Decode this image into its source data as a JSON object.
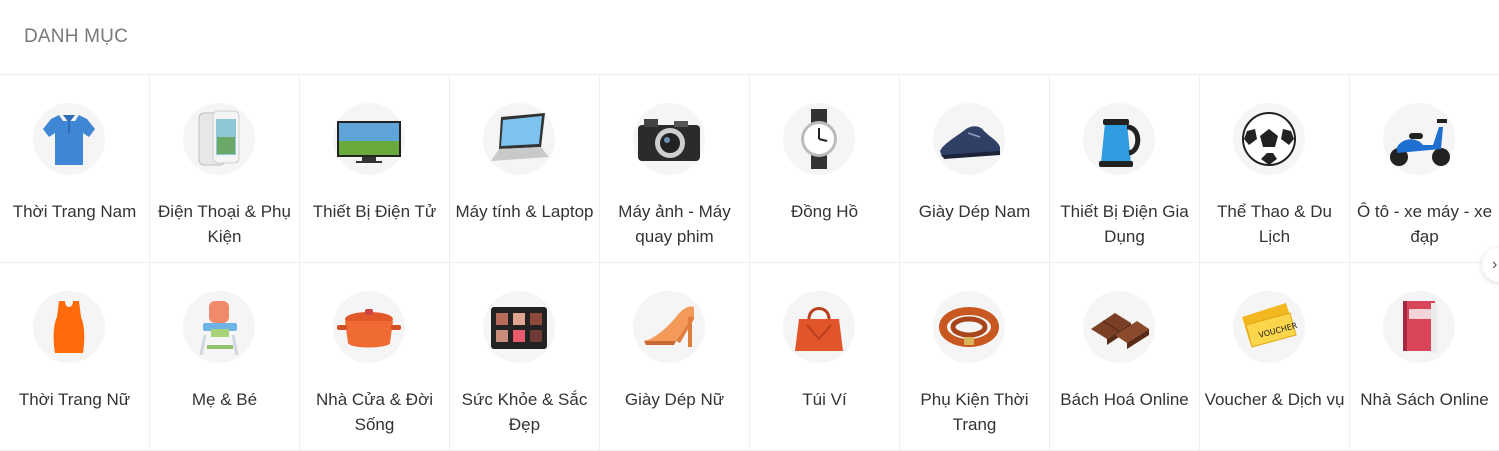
{
  "header": {
    "title": "DANH MỤC"
  },
  "categories": [
    {
      "label": "Thời Trang Nam",
      "icon": "polo-shirt-icon"
    },
    {
      "label": "Điện Thoại & Phụ Kiện",
      "icon": "smartphone-icon"
    },
    {
      "label": "Thiết Bị Điện Tử",
      "icon": "television-icon"
    },
    {
      "label": "Máy tính & Laptop",
      "icon": "laptop-icon"
    },
    {
      "label": "Máy ảnh - Máy quay phim",
      "icon": "camera-icon"
    },
    {
      "label": "Đồng Hồ",
      "icon": "wristwatch-icon"
    },
    {
      "label": "Giày Dép Nam",
      "icon": "men-shoe-icon"
    },
    {
      "label": "Thiết Bị Điện Gia Dụng",
      "icon": "electric-kettle-icon"
    },
    {
      "label": "Thể Thao & Du Lịch",
      "icon": "soccer-ball-icon"
    },
    {
      "label": "Ô tô - xe máy - xe đạp",
      "icon": "scooter-icon"
    },
    {
      "label": "Thời Trang Nữ",
      "icon": "women-top-icon"
    },
    {
      "label": "Mẹ & Bé",
      "icon": "baby-high-chair-icon"
    },
    {
      "label": "Nhà Cửa & Đời Sống",
      "icon": "cooking-pot-icon"
    },
    {
      "label": "Sức Khỏe & Sắc Đẹp",
      "icon": "makeup-palette-icon"
    },
    {
      "label": "Giày Dép Nữ",
      "icon": "high-heel-icon"
    },
    {
      "label": "Túi Ví",
      "icon": "handbag-icon"
    },
    {
      "label": "Phụ Kiện Thời Trang",
      "icon": "bracelet-icon"
    },
    {
      "label": "Bách Hoá Online",
      "icon": "chocolate-icon"
    },
    {
      "label": "Voucher & Dịch vụ",
      "icon": "voucher-ticket-icon"
    },
    {
      "label": "Nhà Sách Online",
      "icon": "book-icon"
    }
  ],
  "next_button": {
    "icon": "chevron-right-icon",
    "glyph": "›"
  },
  "colors": {
    "border": "#eeeeee",
    "title": "#7a7a7a",
    "circle_bg": "#f5f5f5"
  }
}
